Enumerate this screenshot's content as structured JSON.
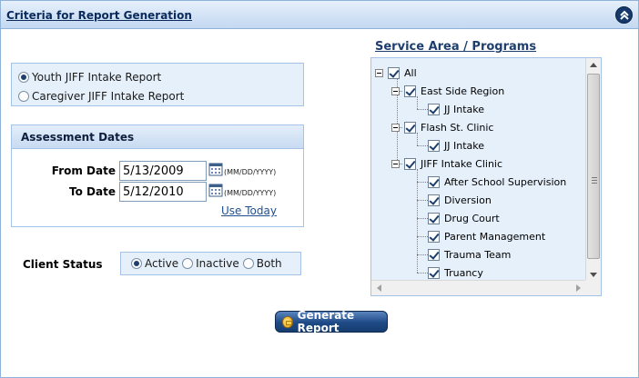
{
  "header": {
    "title": "Criteria for Report Generation"
  },
  "report_types": [
    {
      "label": "Youth JIFF Intake Report",
      "selected": true
    },
    {
      "label": "Caregiver JIFF Intake Report",
      "selected": false
    }
  ],
  "assessment": {
    "title": "Assessment Dates",
    "from_label": "From Date",
    "from_value": "5/13/2009",
    "to_label": "To Date",
    "to_value": "5/12/2010",
    "format_hint": "(MM/DD/YYYY)",
    "use_today": "Use Today"
  },
  "client_status": {
    "label": "Client Status",
    "options": [
      {
        "label": "Active",
        "selected": true
      },
      {
        "label": "Inactive",
        "selected": false
      },
      {
        "label": "Both",
        "selected": false
      }
    ]
  },
  "service_area": {
    "title": "Service Area / Programs",
    "tree": {
      "all": "All",
      "east_side": "East Side Region",
      "east_side_child": "JJ Intake",
      "flash": "Flash St. Clinic",
      "flash_child": "JJ Intake",
      "jiff": "JIFF Intake Clinic",
      "jiff_children": [
        "After School Supervision",
        "Diversion",
        "Drug Court",
        "Parent Management",
        "Trauma Team",
        "Truancy"
      ]
    }
  },
  "actions": {
    "generate_label": "Generate Report"
  },
  "icons": {
    "collapse": "chevron-up-icon",
    "calendar": "calendar-icon",
    "generate": "report-icon"
  },
  "colors": {
    "accent": "#1e4a86",
    "panel": "#e6f0fb",
    "border": "#a5c3e6"
  }
}
